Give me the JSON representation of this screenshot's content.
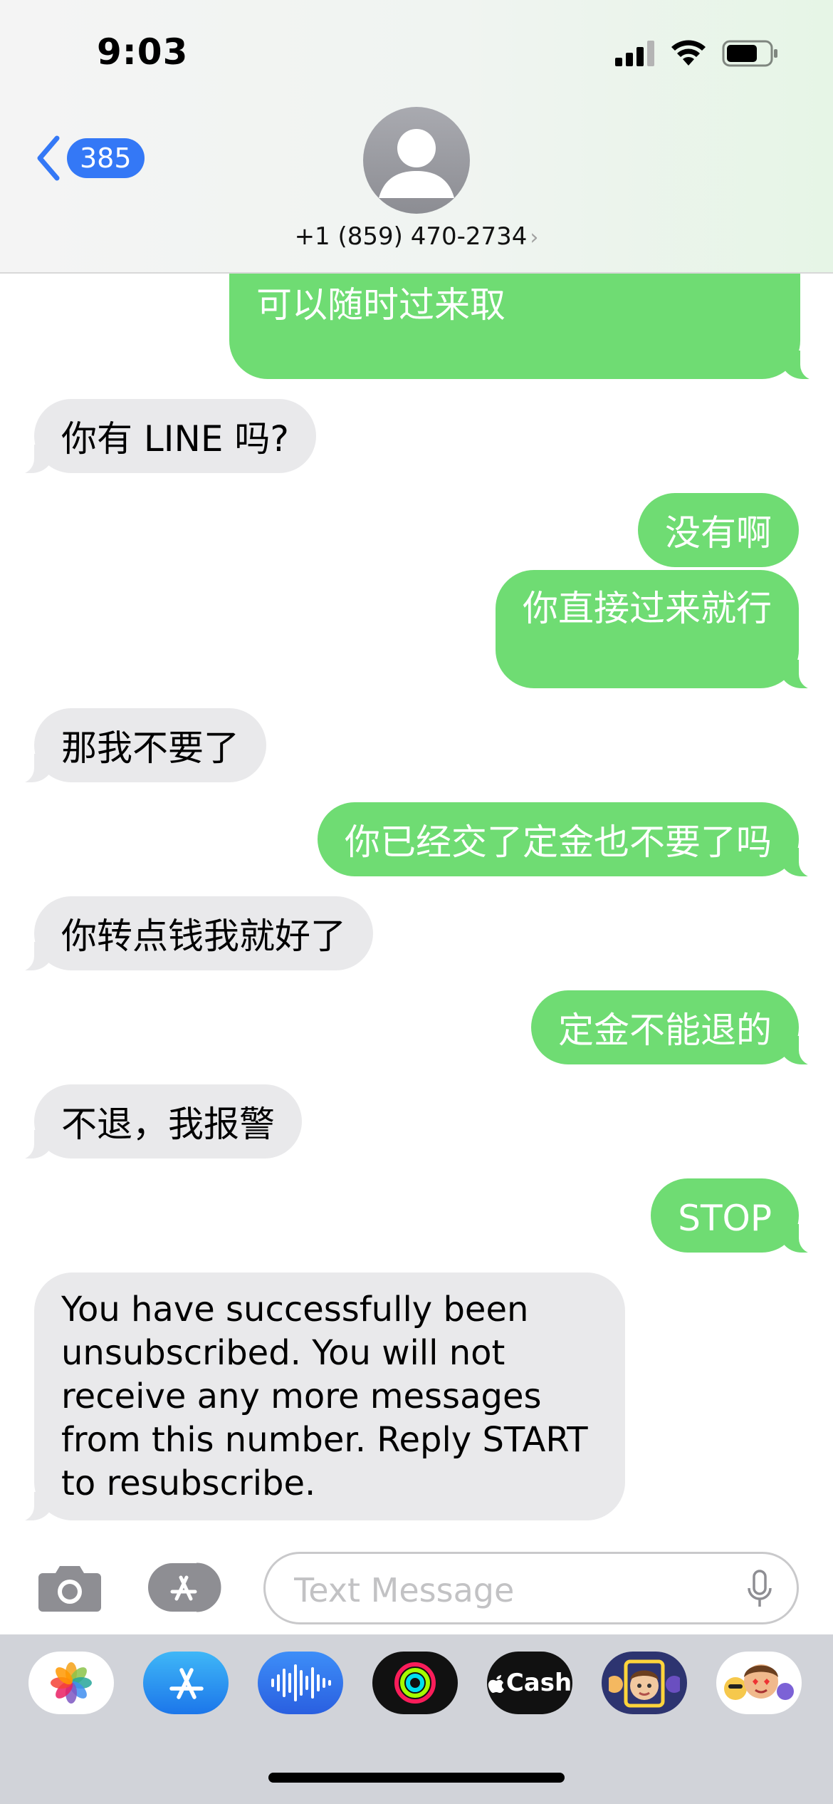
{
  "status_bar": {
    "time": "9:03"
  },
  "nav": {
    "back_count": "385",
    "contact_number": "+1 (859) 470-2734",
    "chevron": "›"
  },
  "messages": [
    {
      "dir": "out",
      "text": "可以随时过来取"
    },
    {
      "dir": "in",
      "text": "你有 LINE 吗?"
    },
    {
      "dir": "out",
      "text": "没有啊"
    },
    {
      "dir": "out",
      "text": "你直接过来就行"
    },
    {
      "dir": "in",
      "text": "那我不要了"
    },
    {
      "dir": "out",
      "text": "你已经交了定金也不要了吗"
    },
    {
      "dir": "in",
      "text": "你转点钱我就好了"
    },
    {
      "dir": "out",
      "text": "定金不能退的"
    },
    {
      "dir": "in",
      "text": "不退，我报警"
    },
    {
      "dir": "out",
      "text": "STOP"
    },
    {
      "dir": "in",
      "text": "You have successfully been unsubscribed. You will not receive any more messages from this number. Reply START to resubscribe."
    }
  ],
  "compose": {
    "placeholder": "Text Message",
    "value": ""
  },
  "dock": {
    "apps": [
      {
        "icon": "photos-icon"
      },
      {
        "icon": "app-store-icon"
      },
      {
        "icon": "audio-message-icon"
      },
      {
        "icon": "fitness-icon"
      },
      {
        "icon": "apple-cash-icon",
        "label": "Cash"
      },
      {
        "icon": "memoji-icon"
      },
      {
        "icon": "stickers-icon"
      }
    ]
  },
  "colors": {
    "accent": "#3478f6",
    "outgoing": "#6fdc73",
    "incoming": "#e9e9eb"
  }
}
